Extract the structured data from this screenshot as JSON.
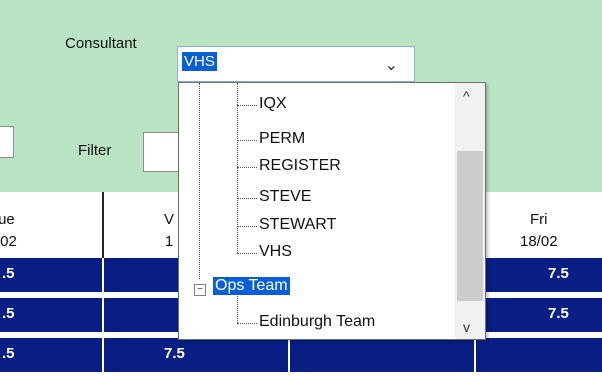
{
  "consultant": {
    "label": "Consultant",
    "value": "VHS",
    "chevron": "chevron-down-icon"
  },
  "filter": {
    "label": "Filter",
    "value": ""
  },
  "columns": [
    {
      "day": "ue",
      "date": "/02"
    },
    {
      "day": "V",
      "date": "1"
    },
    {
      "day": "Fri",
      "date": "18/02"
    }
  ],
  "rows": [
    {
      "c1": ".5",
      "c2": "",
      "c5": "7.5"
    },
    {
      "c1": ".5",
      "c2": "",
      "c5": "7.5"
    },
    {
      "c1": ".5",
      "c2": "7.5",
      "c5": ""
    }
  ],
  "tree": {
    "items": [
      {
        "label": "IQX"
      },
      {
        "label": "PERM"
      },
      {
        "label": "REGISTER"
      },
      {
        "label": "STEVE"
      },
      {
        "label": "STEWART"
      },
      {
        "label": "VHS"
      }
    ],
    "group": {
      "label": "Ops Team",
      "expander": "−"
    },
    "child": {
      "label": "Edinburgh Team"
    }
  },
  "scroll": {
    "up": "^",
    "down": "v"
  }
}
